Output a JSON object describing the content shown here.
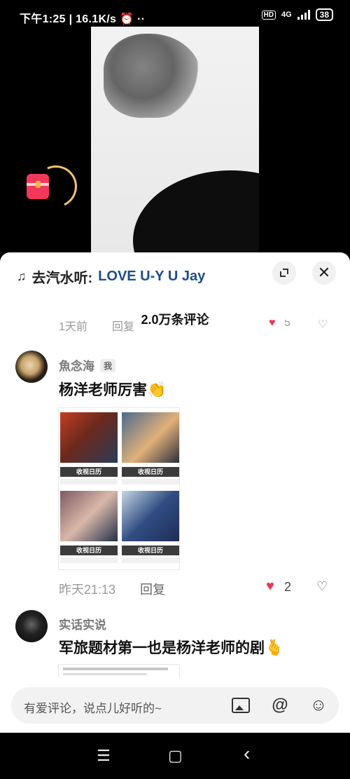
{
  "status": {
    "time": "下午1:25",
    "speed": "16.1K/s",
    "hd": "HD",
    "network": "4G",
    "battery": "38"
  },
  "music": {
    "prefix": "去汽水听:",
    "song": "LOVE U-Y U Jay",
    "note_icon": "music-note-icon"
  },
  "comments_count": "2.0万条评论",
  "partial_row": {
    "time": "1天前",
    "reply": "回复",
    "likes": "5"
  },
  "comments": [
    {
      "user": "魚念海",
      "tag": "我",
      "text": "杨洋老师厉害",
      "emoji": "👏",
      "time": "昨天21:13",
      "reply": "回复",
      "likes": "2",
      "posters": [
        "收视日历",
        "收视日历",
        "收视日历",
        "收视日历"
      ]
    },
    {
      "user": "实话实说",
      "text": "军旅题材第一也是杨洋老师的剧",
      "emoji": "🫰"
    }
  ],
  "input": {
    "placeholder": "有爱评论，说点儿好听的~",
    "at": "@"
  },
  "nav": {
    "menu": "☰",
    "home": "▢",
    "back": "‹"
  },
  "colors": {
    "accent_red": "#ea3551",
    "song_blue": "#1c4d8c"
  }
}
